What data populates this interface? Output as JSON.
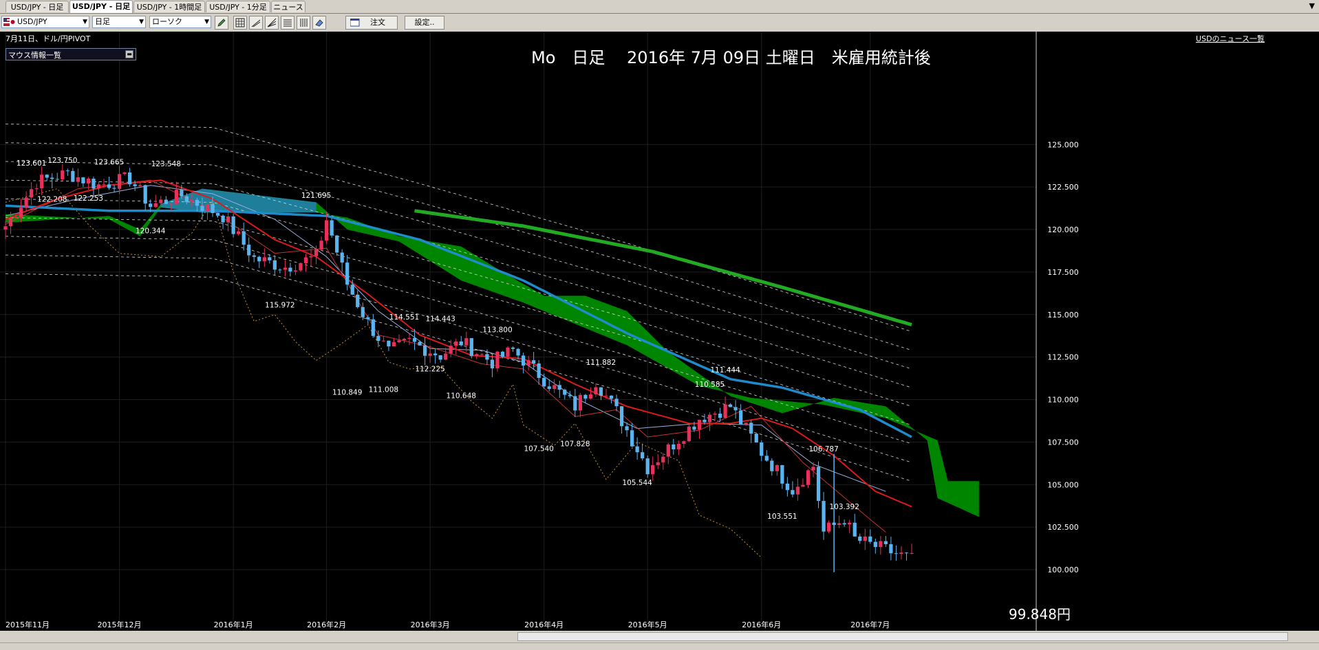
{
  "tabs": [
    {
      "label": "USD/JPY - 日足",
      "active": false
    },
    {
      "label": "USD/JPY - 日足",
      "active": true
    },
    {
      "label": "USD/JPY - 1時間足",
      "active": false
    },
    {
      "label": "USD/JPY - 1分足",
      "active": false
    },
    {
      "label": "ニュース",
      "active": false
    }
  ],
  "toolbar": {
    "symbol": "USD/JPY",
    "timeframe": "日足",
    "chart_type": "ローソク",
    "order_label": "注文",
    "settings_label": "設定.."
  },
  "chart": {
    "header_left": "7月11日、ドル/円PIVOT",
    "mouse_panel_label": "マウス情報一覧",
    "title": "Mo　日足　 2016年 7月 09日 土曜日　米雇用統計後",
    "news_link": "USDのニュース一覧",
    "current_price_label": "99.848円",
    "colors": {
      "up": "#e8305a",
      "down": "#5ab4f0",
      "cloud_bull": "#008c00",
      "cloud_bear": "#1f7f9a",
      "ma_long": "#22aa22",
      "ma_mid": "#1e8ccc",
      "ma_short": "#dd1a1a",
      "background": "#000000"
    }
  },
  "chart_data": {
    "type": "candlestick",
    "y_ticks": [
      "125.000",
      "122.500",
      "120.000",
      "117.500",
      "115.000",
      "112.500",
      "110.000",
      "107.500",
      "105.000",
      "102.500",
      "100.000"
    ],
    "ylim": [
      98.7,
      125.2
    ],
    "x_labels": [
      "2015年11月",
      "2015年12月",
      "2016年1月",
      "2016年2月",
      "2016年3月",
      "2016年4月",
      "2016年5月",
      "2016年6月",
      "2016年7月"
    ],
    "annotations": [
      {
        "text": "123.601",
        "value": 123.601
      },
      {
        "text": "123.750",
        "value": 123.75
      },
      {
        "text": "123.665",
        "value": 123.665
      },
      {
        "text": "123.548",
        "value": 123.548
      },
      {
        "text": "122.208",
        "value": 122.208
      },
      {
        "text": "122.253",
        "value": 122.253
      },
      {
        "text": "120.344",
        "value": 120.344
      },
      {
        "text": "121.695",
        "value": 121.695
      },
      {
        "text": "115.972",
        "value": 115.972
      },
      {
        "text": "114.551",
        "value": 114.551
      },
      {
        "text": "114.443",
        "value": 114.443
      },
      {
        "text": "113.800",
        "value": 113.8
      },
      {
        "text": "112.225",
        "value": 112.225
      },
      {
        "text": "110.849",
        "value": 110.849
      },
      {
        "text": "111.008",
        "value": 111.008
      },
      {
        "text": "110.648",
        "value": 110.648
      },
      {
        "text": "111.882",
        "value": 111.882
      },
      {
        "text": "107.540",
        "value": 107.54
      },
      {
        "text": "107.828",
        "value": 107.828
      },
      {
        "text": "105.544",
        "value": 105.544
      },
      {
        "text": "110.585",
        "value": 110.585
      },
      {
        "text": "111.444",
        "value": 111.444
      },
      {
        "text": "103.551",
        "value": 103.551
      },
      {
        "text": "103.392",
        "value": 103.392
      },
      {
        "text": "106.787",
        "value": 106.787
      }
    ],
    "current_price": 99.848
  }
}
